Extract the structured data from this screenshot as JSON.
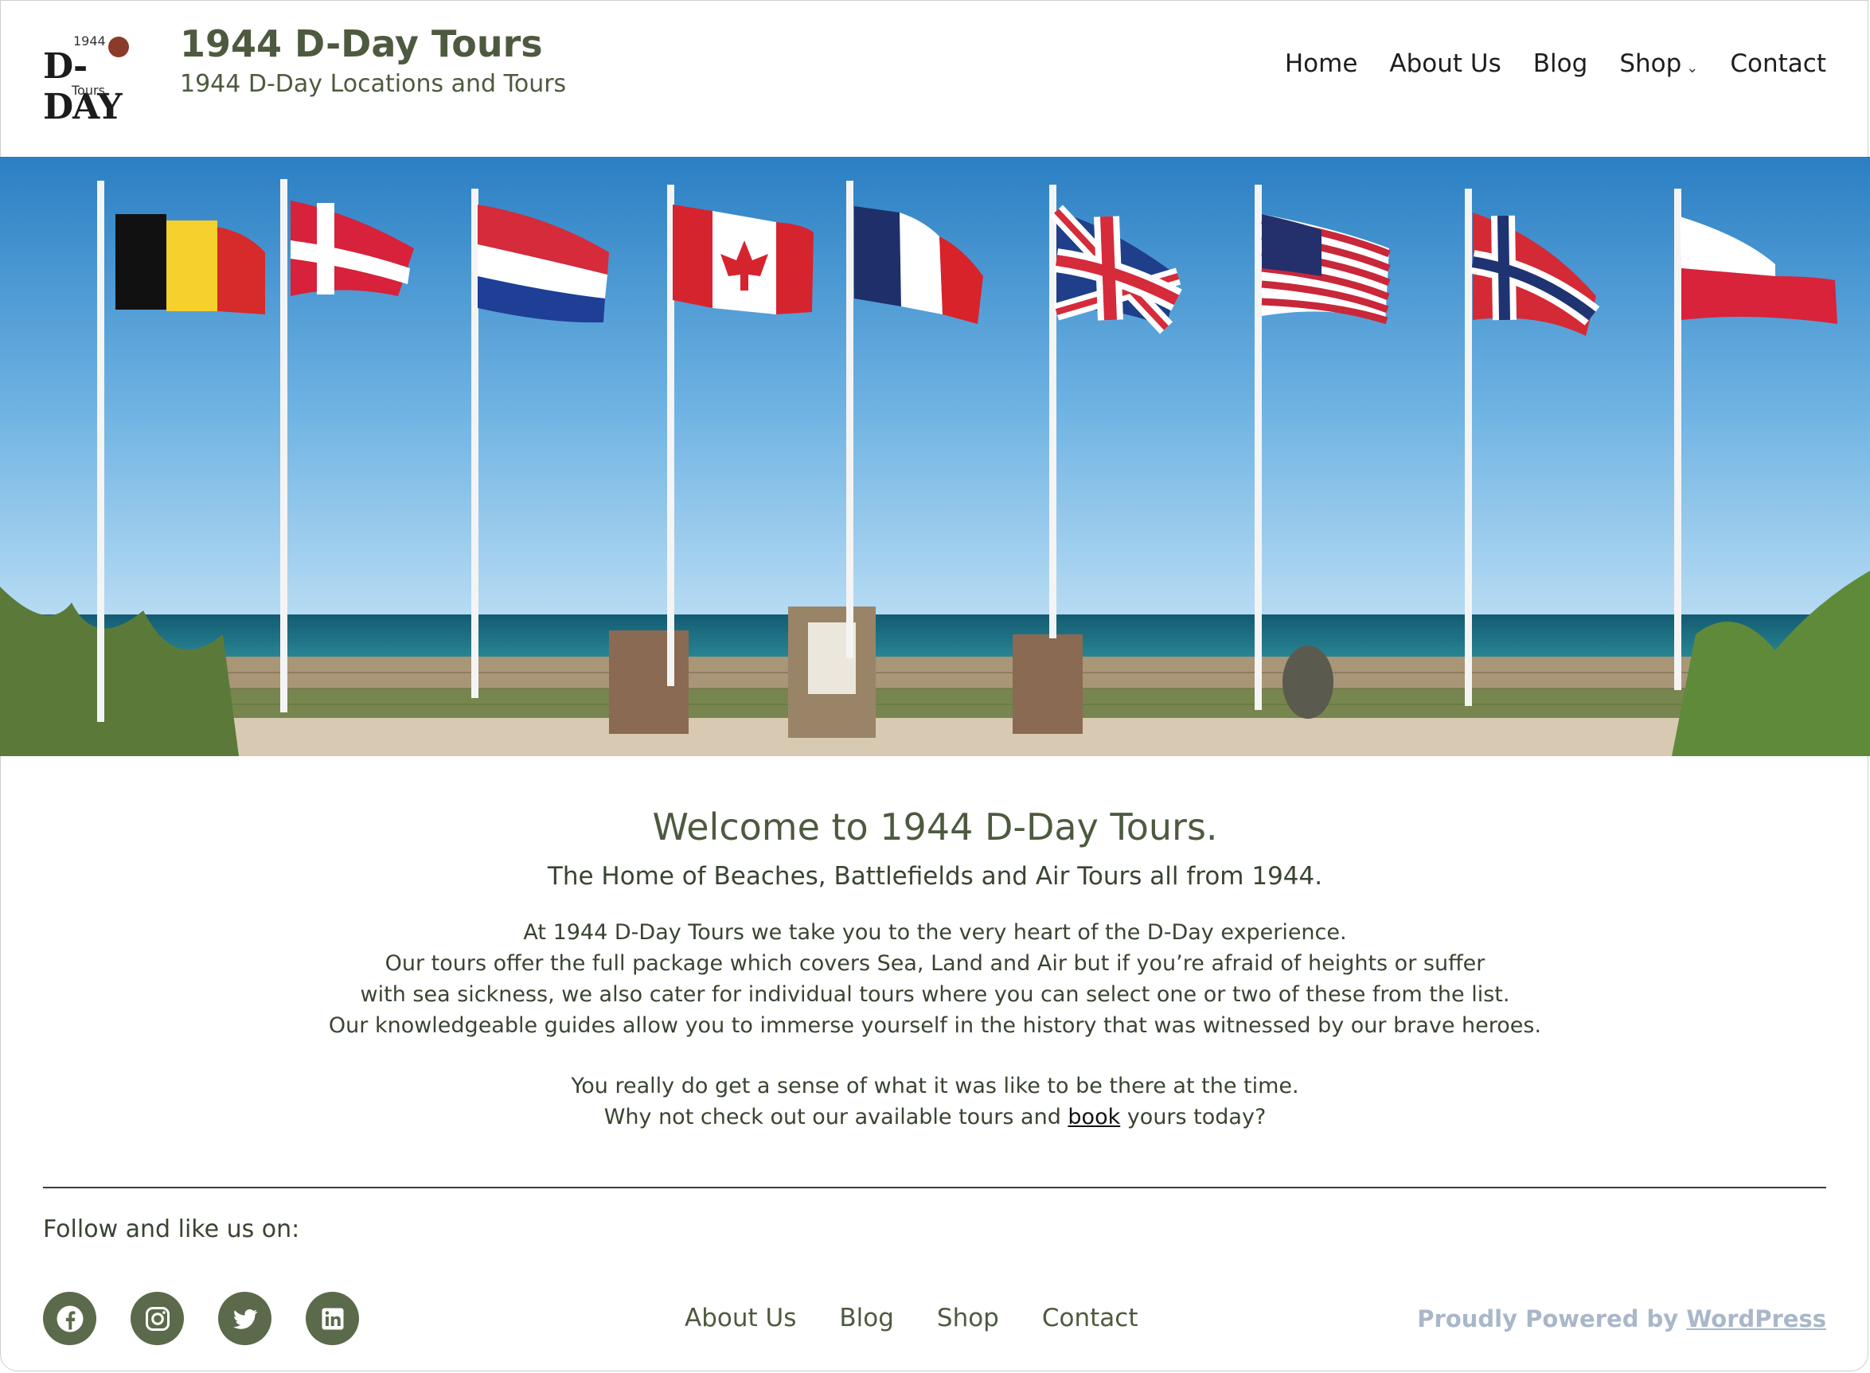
{
  "site": {
    "logo": {
      "small": "1944",
      "big": "D-DAY",
      "tours": "Tours"
    },
    "title": "1944 D-Day Tours",
    "tagline": "1944 D-Day Locations and Tours"
  },
  "nav": {
    "items": [
      "Home",
      "About Us",
      "Blog",
      "Shop",
      "Contact"
    ],
    "shop_has_dropdown": true
  },
  "hero": {
    "description_icons": [
      "flag-belgium",
      "flag-denmark",
      "flag-netherlands",
      "flag-canada",
      "flag-france",
      "flag-uk",
      "flag-usa",
      "flag-norway",
      "flag-poland"
    ]
  },
  "welcome": {
    "title": "Welcome to 1944 D-Day Tours.",
    "subtitle": "The Home of Beaches, Battlefields and Air Tours all from 1944.",
    "paragraph1": [
      "At 1944 D-Day Tours we take you to the very heart of the D-Day experience.",
      "Our tours offer the full package which covers Sea, Land and Air but if you’re afraid of heights or suffer",
      "with sea sickness, we also cater for individual tours where you can select one or two of these from the list.",
      "Our knowledgeable guides allow you to immerse yourself in the history that was witnessed by our brave heroes."
    ],
    "paragraph2_line1": "You really do get a sense of what it was like to be there at the time.",
    "paragraph2_line2_before": "Why not check out our available tours and ",
    "paragraph2_link": "book",
    "paragraph2_line2_after": " yours today?"
  },
  "footer": {
    "follow": "Follow and like us on:",
    "socials": [
      "facebook-icon",
      "instagram-icon",
      "twitter-icon",
      "linkedin-icon"
    ],
    "nav": [
      "About Us",
      "Blog",
      "Shop",
      "Contact"
    ],
    "powered_prefix": "Proudly Powered by ",
    "powered_link": "WordPress"
  },
  "colors": {
    "accent": "#4d5a3f",
    "social_bg": "#5a6a4a",
    "powered": "#a9b7c9"
  }
}
